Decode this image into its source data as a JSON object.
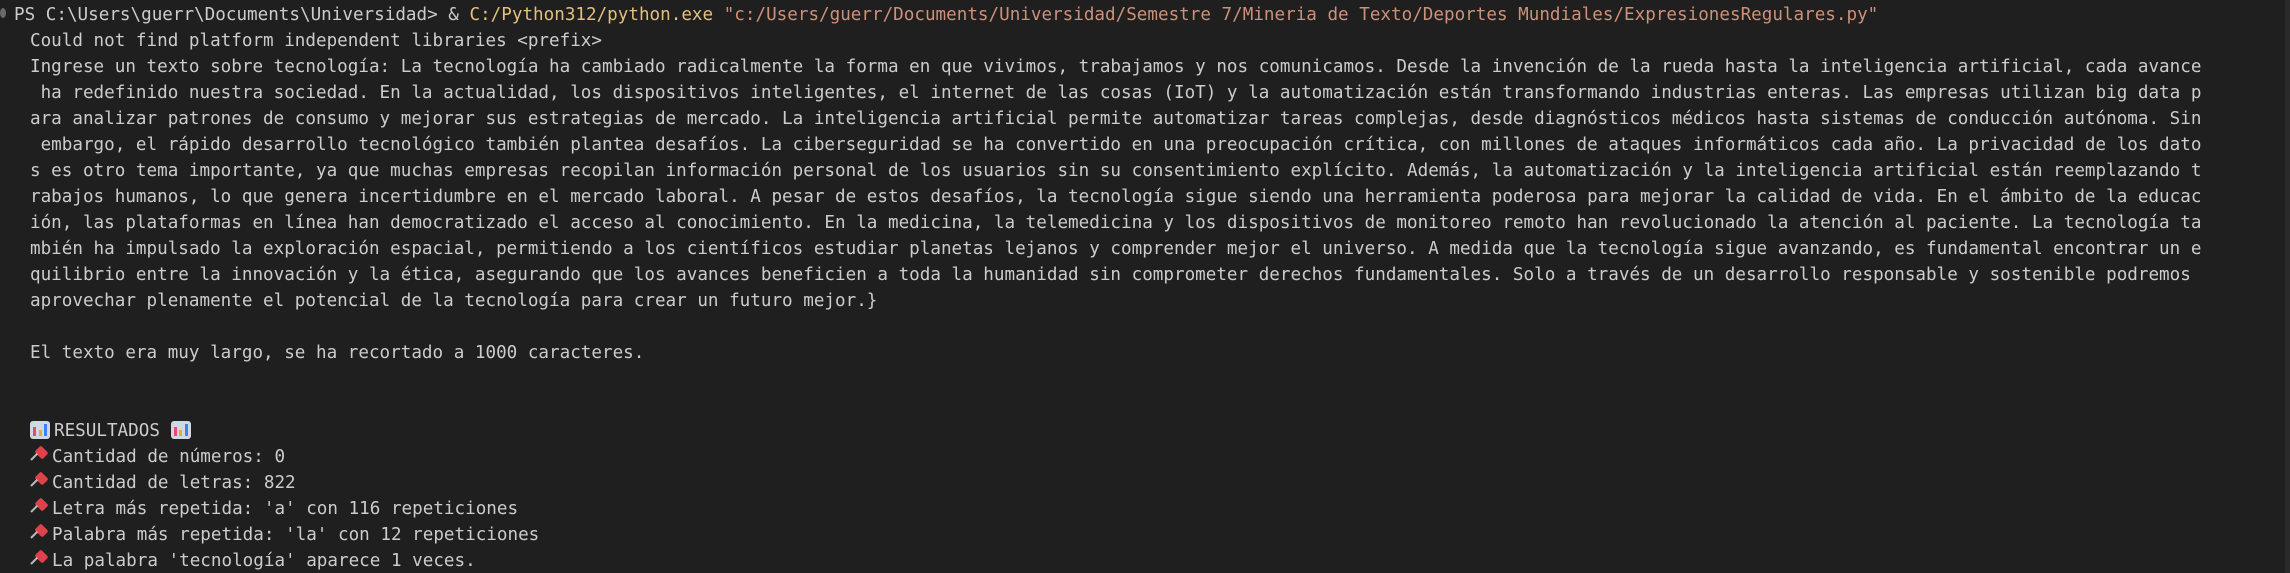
{
  "terminal": {
    "prompt_prefix": "PS C:\\Users\\guerr\\Documents\\Universidad> & ",
    "executable": "C:/Python312/python.exe",
    "script_path": "\"c:/Users/guerr/Documents/Universidad/Semestre 7/Mineria de Texto/Deportes Mundiales/ExpresionesRegulares.py\"",
    "warning": "Could not find platform independent libraries <prefix>",
    "input_lines": [
      "Ingrese un texto sobre tecnología: La tecnología ha cambiado radicalmente la forma en que vivimos, trabajamos y nos comunicamos. Desde la invención de la rueda hasta la inteligencia artificial, cada avance",
      " ha redefinido nuestra sociedad. En la actualidad, los dispositivos inteligentes, el internet de las cosas (IoT) y la automatización están transformando industrias enteras. Las empresas utilizan big data p",
      "ara analizar patrones de consumo y mejorar sus estrategias de mercado. La inteligencia artificial permite automatizar tareas complejas, desde diagnósticos médicos hasta sistemas de conducción autónoma. Sin",
      " embargo, el rápido desarrollo tecnológico también plantea desafíos. La ciberseguridad se ha convertido en una preocupación crítica, con millones de ataques informáticos cada año. La privacidad de los dato",
      "s es otro tema importante, ya que muchas empresas recopilan información personal de los usuarios sin su consentimiento explícito. Además, la automatización y la inteligencia artificial están reemplazando t",
      "rabajos humanos, lo que genera incertidumbre en el mercado laboral. A pesar de estos desafíos, la tecnología sigue siendo una herramienta poderosa para mejorar la calidad de vida. En el ámbito de la educac",
      "ión, las plataformas en línea han democratizado el acceso al conocimiento. En la medicina, la telemedicina y los dispositivos de monitoreo remoto han revolucionado la atención al paciente. La tecnología ta",
      "mbién ha impulsado la exploración espacial, permitiendo a los científicos estudiar planetas lejanos y comprender mejor el universo. A medida que la tecnología sigue avanzando, es fundamental encontrar un e",
      "quilibrio entre la innovación y la ética, asegurando que los avances beneficien a toda la humanidad sin comprometer derechos fundamentales. Solo a través de un desarrollo responsable y sostenible podremos",
      "aprovechar plenamente el potencial de la tecnología para crear un futuro mejor.}"
    ],
    "truncation_notice": "El texto era muy largo, se ha recortado a 1000 caracteres.",
    "results_title": "RESULTADOS",
    "results": [
      "Cantidad de números: 0",
      "Cantidad de letras: 822",
      "Letra más repetida: 'a' con 116 repeticiones",
      "Palabra más repetida: 'la' con 12 repeticiones",
      "La palabra 'tecnología' aparece 1 veces."
    ],
    "icons": {
      "results": "bar-chart-icon",
      "result_items": "pushpin-icon"
    }
  }
}
